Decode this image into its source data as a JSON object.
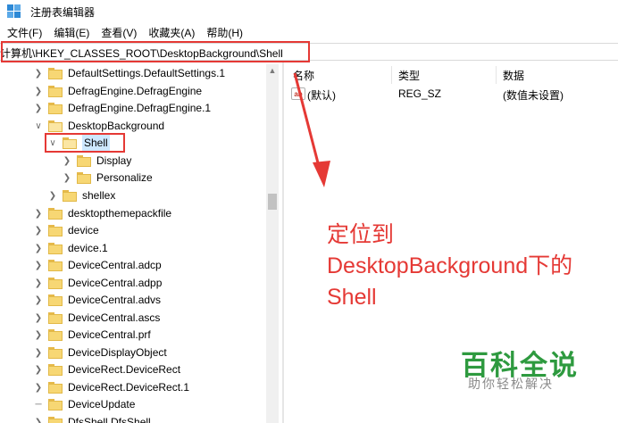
{
  "window": {
    "title": "注册表编辑器"
  },
  "menu": [
    "文件(F)",
    "编辑(E)",
    "查看(V)",
    "收藏夹(A)",
    "帮助(H)"
  ],
  "address": {
    "path": "计算机\\HKEY_CLASSES_ROOT\\DesktopBackground\\Shell"
  },
  "tree": {
    "items": [
      {
        "label": "DefaultSettings.DefaultSettings.1",
        "state": "collapsed"
      },
      {
        "label": "DefragEngine.DefragEngine",
        "state": "collapsed"
      },
      {
        "label": "DefragEngine.DefragEngine.1",
        "state": "collapsed"
      },
      {
        "label": "DesktopBackground",
        "state": "expanded"
      },
      {
        "label": "Shell",
        "state": "expanded",
        "selected": true
      },
      {
        "label": "Display",
        "state": "collapsed"
      },
      {
        "label": "Personalize",
        "state": "collapsed"
      },
      {
        "label": "shellex",
        "state": "collapsed"
      },
      {
        "label": "desktopthemepackfile",
        "state": "collapsed"
      },
      {
        "label": "device",
        "state": "collapsed"
      },
      {
        "label": "device.1",
        "state": "collapsed"
      },
      {
        "label": "DeviceCentral.adcp",
        "state": "collapsed"
      },
      {
        "label": "DeviceCentral.adpp",
        "state": "collapsed"
      },
      {
        "label": "DeviceCentral.advs",
        "state": "collapsed"
      },
      {
        "label": "DeviceCentral.ascs",
        "state": "collapsed"
      },
      {
        "label": "DeviceCentral.prf",
        "state": "collapsed"
      },
      {
        "label": "DeviceDisplayObject",
        "state": "collapsed"
      },
      {
        "label": "DeviceRect.DeviceRect",
        "state": "collapsed"
      },
      {
        "label": "DeviceRect.DeviceRect.1",
        "state": "collapsed"
      },
      {
        "label": "DeviceUpdate",
        "state": "leaf"
      },
      {
        "label": "DfsShell.DfsShell",
        "state": "collapsed"
      }
    ]
  },
  "list": {
    "columns": [
      "名称",
      "类型",
      "数据"
    ],
    "rows": [
      {
        "name": "(默认)",
        "type": "REG_SZ",
        "data": "(数值未设置)",
        "icon": "ab-string-icon"
      }
    ]
  },
  "annotation": {
    "line1": "定位到",
    "line2": "DesktopBackground下的",
    "line3": "Shell",
    "color": "#e53935"
  },
  "watermark": {
    "main": "百科全说",
    "sub": "助你轻松解决"
  }
}
